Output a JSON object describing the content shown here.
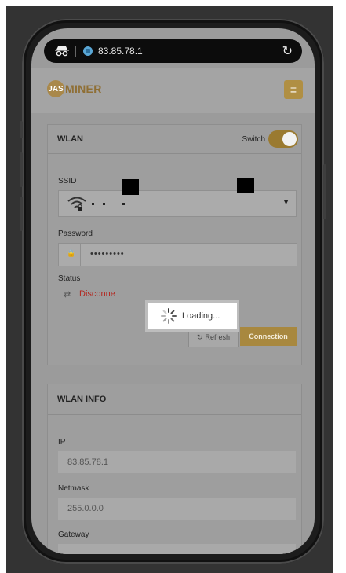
{
  "browser": {
    "url": "83.85.78.1",
    "icons": {
      "incognito": "incognito-icon",
      "site": "site-info-icon",
      "reload": "reload-icon"
    }
  },
  "header": {
    "logo_prefix": "JAS",
    "logo_word": "MINER",
    "menu_icon": "hamburger-icon",
    "accent": "#a8883f"
  },
  "wlan": {
    "title": "WLAN",
    "switch_label": "Switch",
    "switch_on": true,
    "ssid_label": "SSID",
    "ssid_value": "",
    "password_label": "Password",
    "password_value": "•••••••••",
    "status_label": "Status",
    "status_value": "Disconne",
    "refresh_label": "Refresh",
    "connect_label": "Connection"
  },
  "loading": {
    "text": "Loading..."
  },
  "wlan_info": {
    "title": "WLAN INFO",
    "ip_label": "IP",
    "ip_value": "83.85.78.1",
    "netmask_label": "Netmask",
    "netmask_value": "255.0.0.0",
    "gateway_label": "Gateway"
  }
}
